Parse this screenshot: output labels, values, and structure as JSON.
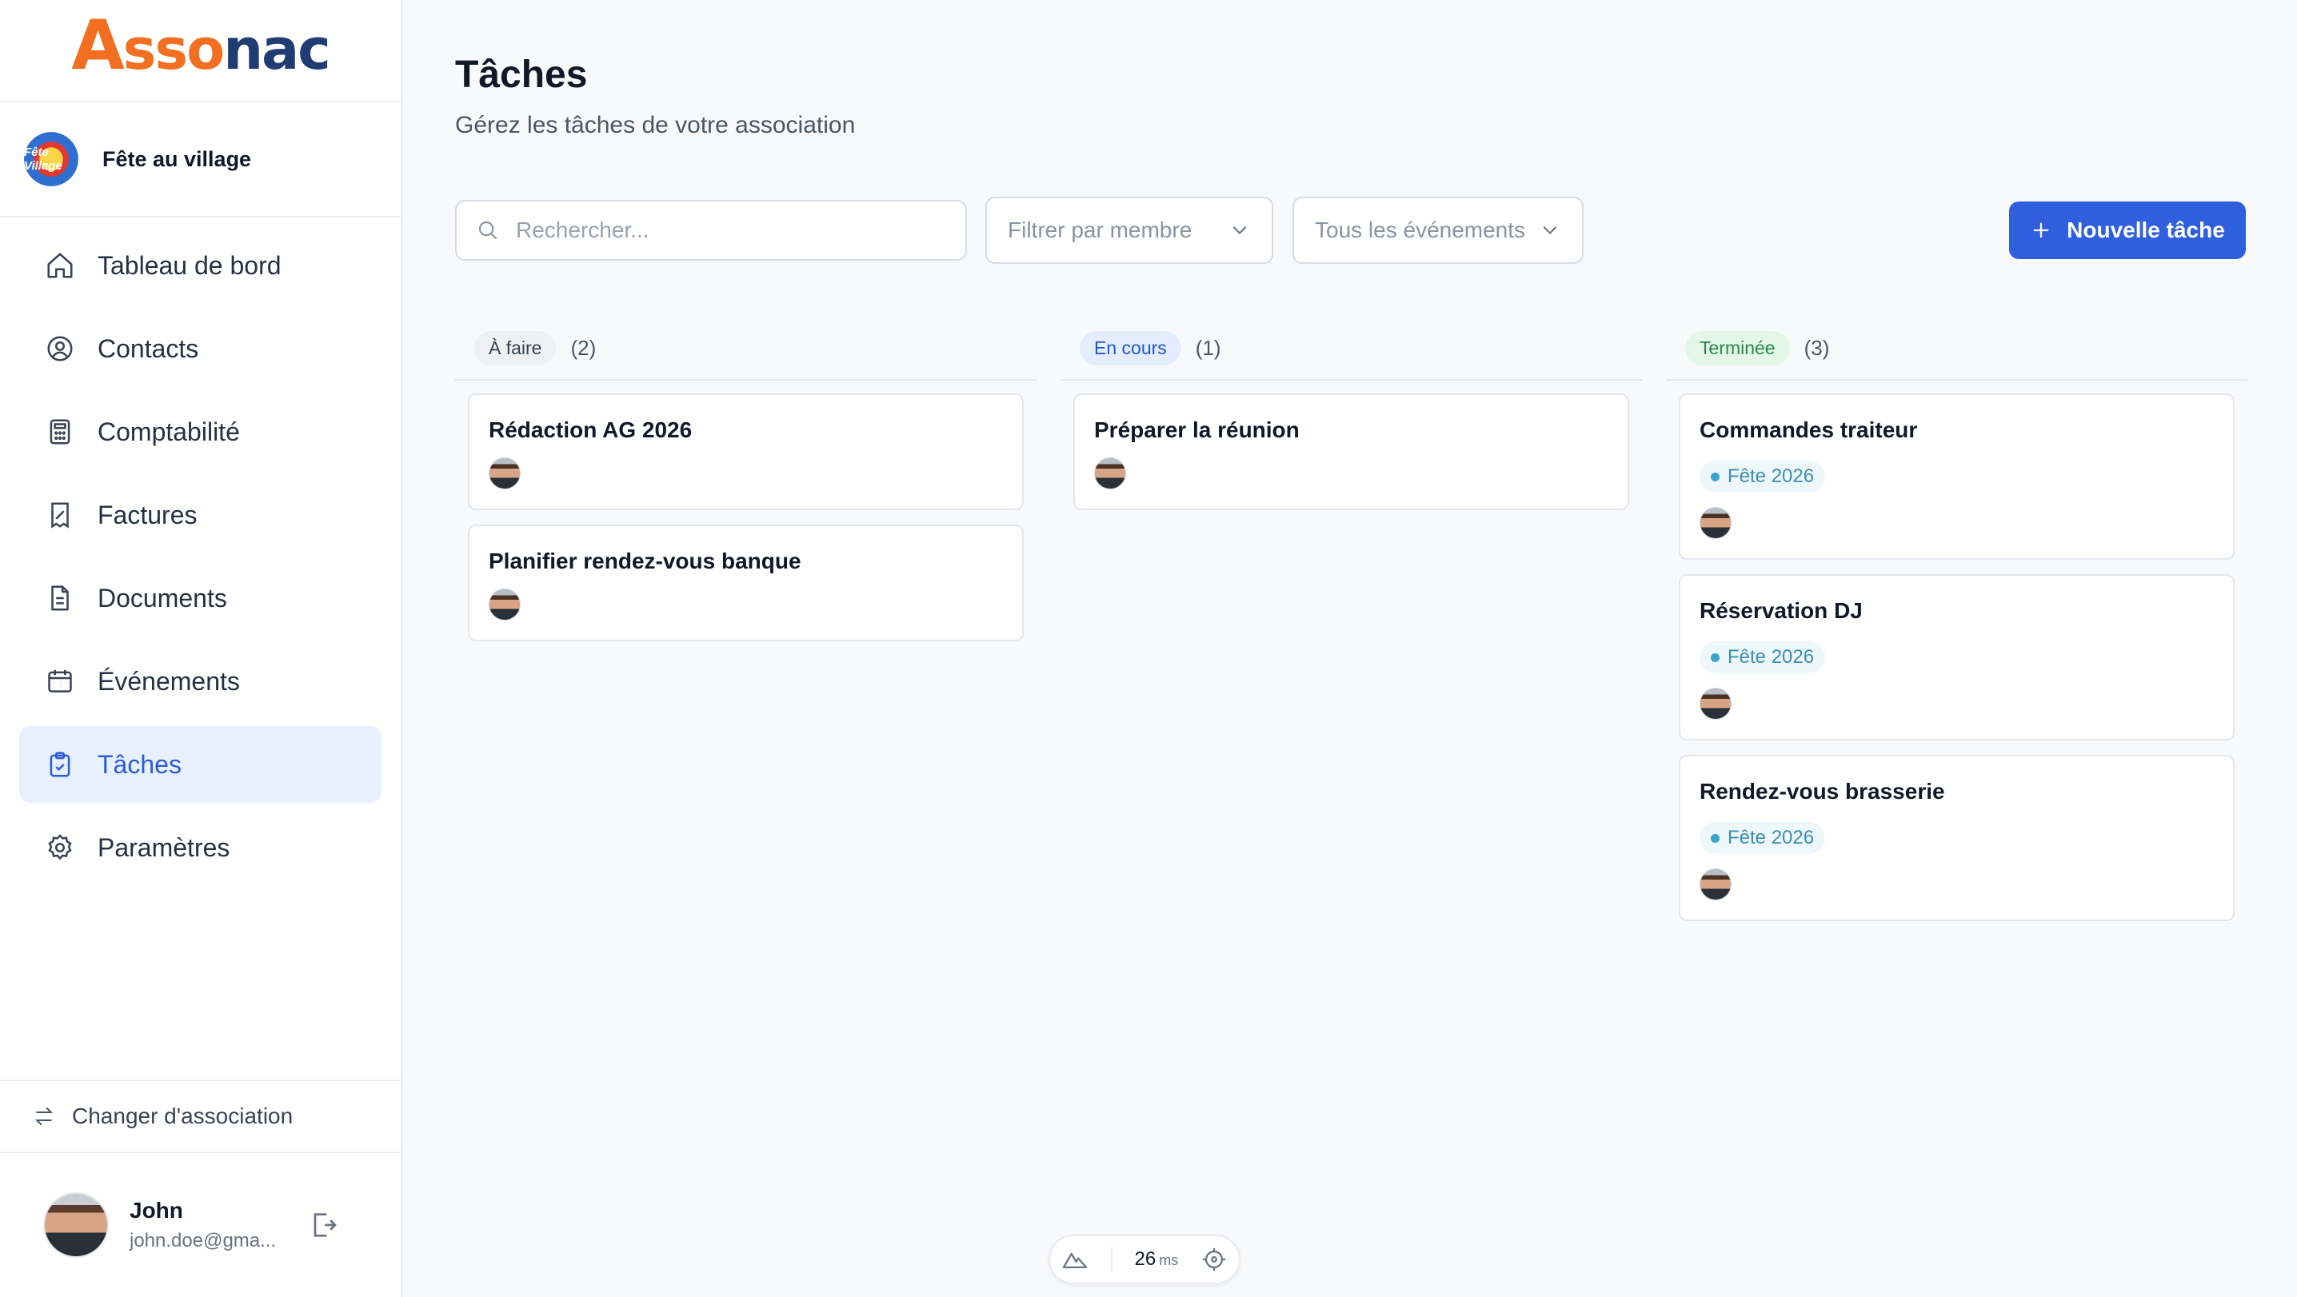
{
  "brand": {
    "logo_a": "A",
    "logo_ss": "sso",
    "logo_nac": "nac"
  },
  "association": {
    "name": "Fête au village",
    "badge_text": "Fête Village"
  },
  "nav": [
    {
      "label": "Tableau de bord",
      "icon": "home-icon"
    },
    {
      "label": "Contacts",
      "icon": "user-circle-icon"
    },
    {
      "label": "Comptabilité",
      "icon": "calculator-icon"
    },
    {
      "label": "Factures",
      "icon": "invoice-icon"
    },
    {
      "label": "Documents",
      "icon": "document-icon"
    },
    {
      "label": "Événements",
      "icon": "calendar-icon"
    },
    {
      "label": "Tâches",
      "icon": "clipboard-check-icon",
      "active": true
    },
    {
      "label": "Paramètres",
      "icon": "gear-icon"
    }
  ],
  "switch_label": "Changer d'association",
  "user": {
    "name": "John",
    "email": "john.doe@gma..."
  },
  "page": {
    "title": "Tâches",
    "subtitle": "Gérez les tâches de votre association"
  },
  "toolbar": {
    "search_placeholder": "Rechercher...",
    "member_filter": "Filtrer par membre",
    "event_filter": "Tous les événements",
    "new_task": "Nouvelle tâche"
  },
  "columns": [
    {
      "status": "À faire",
      "count": "(2)",
      "cards": [
        {
          "title": "Rédaction AG 2026"
        },
        {
          "title": "Planifier rendez-vous banque"
        }
      ]
    },
    {
      "status": "En cours",
      "count": "(1)",
      "cards": [
        {
          "title": "Préparer la réunion"
        }
      ]
    },
    {
      "status": "Terminée",
      "count": "(3)",
      "cards": [
        {
          "title": "Commandes traiteur",
          "tag": "Fête 2026"
        },
        {
          "title": "Réservation DJ",
          "tag": "Fête 2026"
        },
        {
          "title": "Rendez-vous brasserie",
          "tag": "Fête 2026"
        }
      ]
    }
  ],
  "perf": {
    "value": "26",
    "unit": "ms"
  },
  "colors": {
    "accent": "#2f5fdc",
    "brand_orange": "#f26f21",
    "brand_navy": "#1f3c73"
  }
}
